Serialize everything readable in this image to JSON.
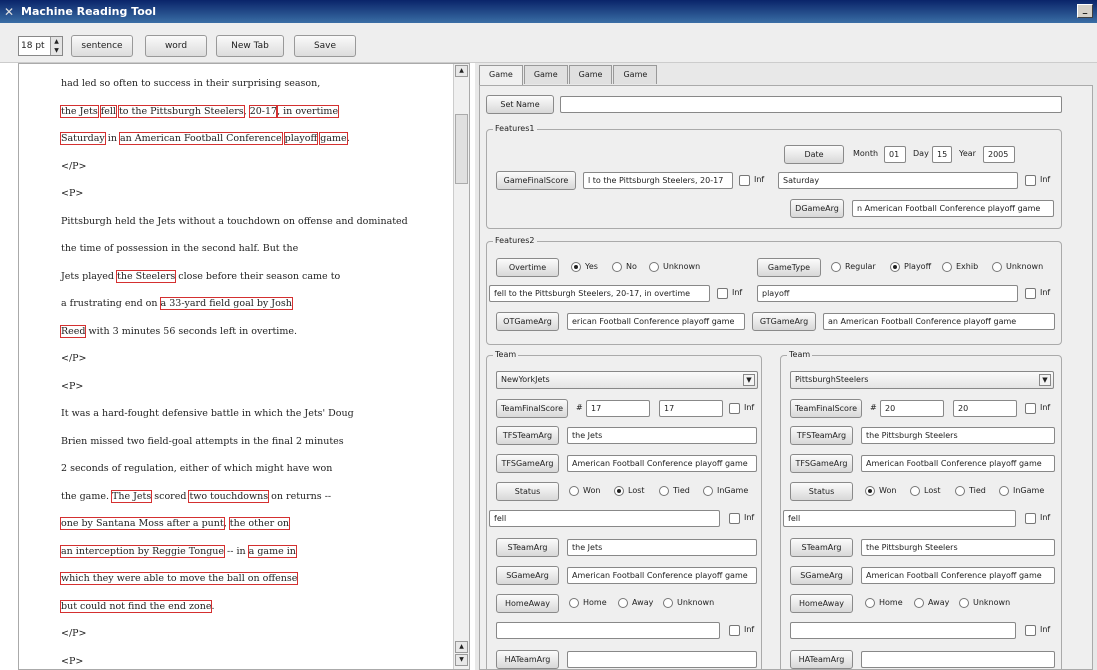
{
  "window": {
    "title": "Machine Reading Tool",
    "min_label": "_",
    "close_label": "□"
  },
  "toolbar": {
    "font_size": "18 pt",
    "sentence": "sentence",
    "word": "word",
    "new_tab": "New Tab",
    "save": "Save"
  },
  "text_lines": [
    [
      {
        "t": "had led so often to success in their surprising season,",
        "h": false
      }
    ],
    [
      {
        "t": "the Jets",
        "h": true
      },
      {
        "t": " ",
        "h": false
      },
      {
        "t": "fell",
        "h": true
      },
      {
        "t": " ",
        "h": false
      },
      {
        "t": "to the Pittsburgh Steelers",
        "h": true
      },
      {
        "t": ", ",
        "h": false
      },
      {
        "t": "20-17",
        "h": true
      },
      {
        "t": ", in overtime",
        "h": true
      }
    ],
    [
      {
        "t": "Saturday",
        "h": true
      },
      {
        "t": " in ",
        "h": false
      },
      {
        "t": "an American Football Conference",
        "h": true
      },
      {
        "t": " ",
        "h": false
      },
      {
        "t": "playoff",
        "h": true
      },
      {
        "t": " ",
        "h": false
      },
      {
        "t": "game",
        "h": true
      },
      {
        "t": ".",
        "h": false
      }
    ],
    [
      {
        "t": "</P>",
        "h": false
      }
    ],
    [
      {
        "t": "<P>",
        "h": false
      }
    ],
    [
      {
        "t": "Pittsburgh held the Jets without a touchdown on offense and dominated",
        "h": false
      }
    ],
    [
      {
        "t": "the time of possession in the second half. But the",
        "h": false
      }
    ],
    [
      {
        "t": "Jets played ",
        "h": false
      },
      {
        "t": "the Steelers",
        "h": true
      },
      {
        "t": " close before their season came to",
        "h": false
      }
    ],
    [
      {
        "t": "a frustrating end on ",
        "h": false
      },
      {
        "t": "a 33-yard field goal by Josh",
        "h": true
      }
    ],
    [
      {
        "t": "Reed",
        "h": true
      },
      {
        "t": " with 3 minutes 56 seconds left in overtime.",
        "h": false
      }
    ],
    [
      {
        "t": "</P>",
        "h": false
      }
    ],
    [
      {
        "t": "<P>",
        "h": false
      }
    ],
    [
      {
        "t": "It was a hard-fought defensive battle in which the Jets' Doug",
        "h": false
      }
    ],
    [
      {
        "t": "Brien missed two field-goal attempts in the final 2 minutes",
        "h": false
      }
    ],
    [
      {
        "t": "2 seconds of regulation, either of which might have won",
        "h": false
      }
    ],
    [
      {
        "t": "the game. ",
        "h": false
      },
      {
        "t": "The Jets",
        "h": true
      },
      {
        "t": " scored ",
        "h": false
      },
      {
        "t": "two touchdowns",
        "h": true
      },
      {
        "t": " on returns --",
        "h": false
      }
    ],
    [
      {
        "t": "one by Santana Moss after a punt",
        "h": true
      },
      {
        "t": ", ",
        "h": false
      },
      {
        "t": "the other on",
        "h": true
      }
    ],
    [
      {
        "t": "an interception by Reggie Tongue",
        "h": true
      },
      {
        "t": " -- in ",
        "h": false
      },
      {
        "t": "a game in",
        "h": true
      }
    ],
    [
      {
        "t": "which they were able to move the ball on offense",
        "h": true
      }
    ],
    [
      {
        "t": "but could not find the end zone",
        "h": true
      },
      {
        "t": ".",
        "h": false
      }
    ],
    [
      {
        "t": "</P>",
        "h": false
      }
    ],
    [
      {
        "t": "<P>",
        "h": false
      }
    ]
  ],
  "tabs": [
    "Game",
    "Game",
    "Game",
    "Game"
  ],
  "set_name": {
    "button": "Set Name",
    "value": ""
  },
  "features1": {
    "title": "Features1",
    "date_button": "Date",
    "month_label": "Month",
    "month": "01",
    "day_label": "Day",
    "day": "15",
    "year_label": "Year",
    "year": "2005",
    "gfs_button": "GameFinalScore",
    "gfs_value": "l to the Pittsburgh Steelers, 20-17",
    "inf": "Inf",
    "date_value": "Saturday",
    "dgamearg_button": "DGameArg",
    "dgamearg_value": "n American Football Conference playoff game"
  },
  "features2": {
    "title": "Features2",
    "overtime_button": "Overtime",
    "ot_yes": "Yes",
    "ot_no": "No",
    "ot_unknown": "Unknown",
    "gametype_button": "GameType",
    "gt_regular": "Regular",
    "gt_playoff": "Playoff",
    "gt_exhib": "Exhib",
    "gt_unknown": "Unknown",
    "ot_value": "fell to the Pittsburgh Steelers, 20-17, in overtime",
    "inf": "Inf",
    "gt_value": "playoff",
    "otgamearg_button": "OTGameArg",
    "otgamearg_value": "erican Football Conference playoff game",
    "gtgamearg_button": "GTGameArg",
    "gtgamearg_value": "an American Football Conference playoff game"
  },
  "team_left": {
    "title": "Team",
    "team": "NewYorkJets",
    "tfs_button": "TeamFinalScore",
    "hash": "#",
    "score1": "17",
    "score2": "17",
    "inf": "Inf",
    "tfsteam_button": "TFSTeamArg",
    "tfsteam_value": "the Jets",
    "tfsgame_button": "TFSGameArg",
    "tfsgame_value": "American Football Conference playoff game",
    "status_button": "Status",
    "won": "Won",
    "lost": "Lost",
    "tied": "Tied",
    "ingame": "InGame",
    "status_value": "fell",
    "steam_button": "STeamArg",
    "steam_value": "the Jets",
    "sgame_button": "SGameArg",
    "sgame_value": "American Football Conference playoff game",
    "homeaway_button": "HomeAway",
    "home": "Home",
    "away": "Away",
    "unknown": "Unknown",
    "ha_value": "",
    "hateam_button": "HATeamArg"
  },
  "team_right": {
    "title": "Team",
    "team": "PittsburghSteelers",
    "tfs_button": "TeamFinalScore",
    "hash": "#",
    "score1": "20",
    "score2": "20",
    "inf": "Inf",
    "tfsteam_button": "TFSTeamArg",
    "tfsteam_value": "the Pittsburgh Steelers",
    "tfsgame_button": "TFSGameArg",
    "tfsgame_value": "American Football Conference playoff game",
    "status_button": "Status",
    "won": "Won",
    "lost": "Lost",
    "tied": "Tied",
    "ingame": "InGame",
    "status_value": "fell",
    "steam_button": "STeamArg",
    "steam_value": "the Pittsburgh Steelers",
    "sgame_button": "SGameArg",
    "sgame_value": "American Football Conference playoff game",
    "homeaway_button": "HomeAway",
    "home": "Home",
    "away": "Away",
    "unknown": "Unknown",
    "ha_value": "",
    "hateam_button": "HATeamArg"
  },
  "colors": {
    "highlight": "#d43030",
    "titlebar": "#0a246a"
  }
}
